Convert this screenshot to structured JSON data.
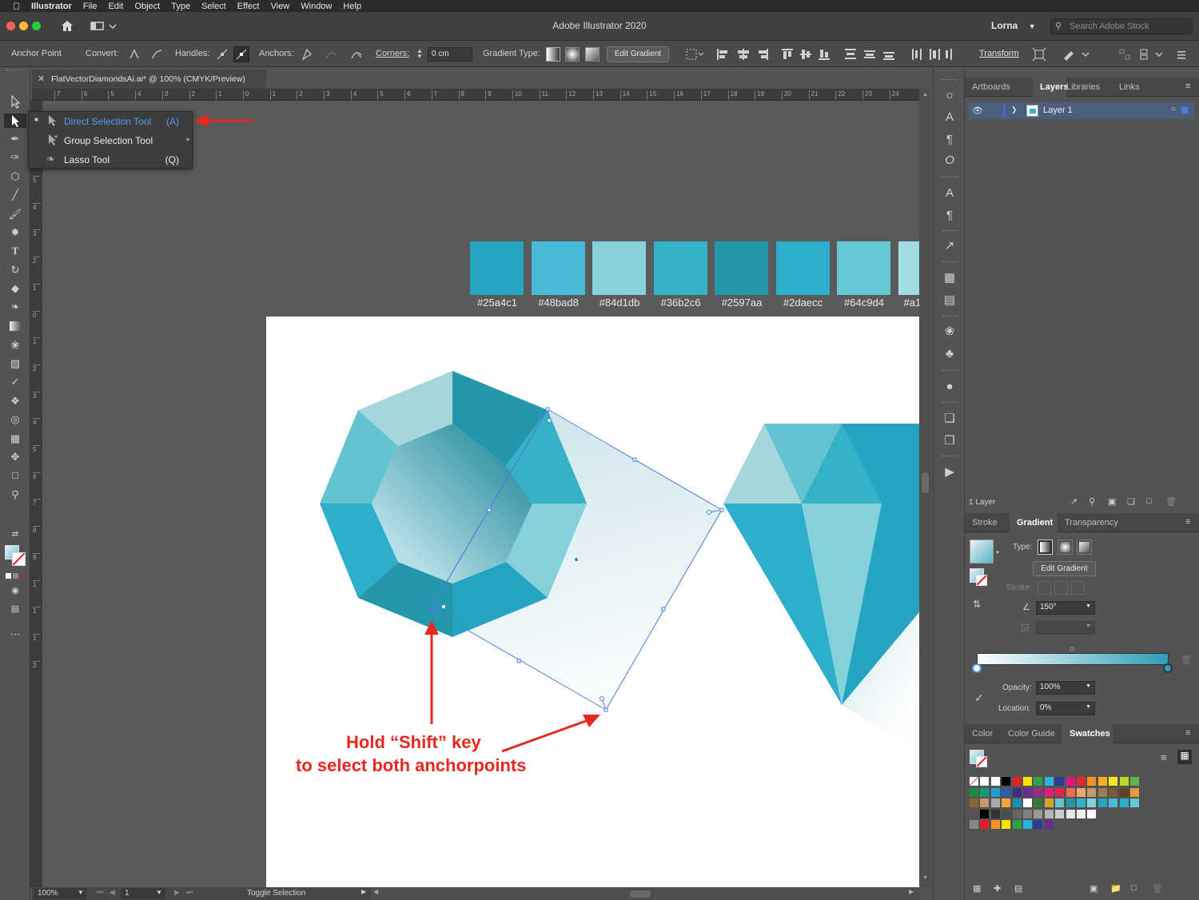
{
  "menubar": {
    "apple": "",
    "app": "Illustrator",
    "items": [
      "File",
      "Edit",
      "Object",
      "Type",
      "Select",
      "Effect",
      "View",
      "Window",
      "Help"
    ]
  },
  "titlebar": {
    "title": "Adobe Illustrator 2020",
    "user": "Lorna",
    "search_placeholder": "Search Adobe Stock"
  },
  "controlbar": {
    "context": "Anchor Point",
    "convert": "Convert:",
    "handles": "Handles:",
    "anchors": "Anchors:",
    "corners": "Corners:",
    "corners_value": "0 cm",
    "gradient_type": "Gradient Type:",
    "edit_gradient": "Edit Gradient",
    "transform": "Transform"
  },
  "document": {
    "tab_title": "FlatVectorDiamondsAi.ai* @ 100% (CMYK/Preview)"
  },
  "ruler_top": [
    "7",
    "6",
    "5",
    "4",
    "3",
    "2",
    "1",
    "0",
    "1",
    "2",
    "3",
    "4",
    "5",
    "6",
    "7",
    "8",
    "9",
    "10",
    "11",
    "12",
    "13",
    "14",
    "15",
    "16",
    "17",
    "18",
    "19",
    "20",
    "21",
    "22",
    "23",
    "24"
  ],
  "ruler_left": [
    "5",
    "4",
    "3",
    "2",
    "1",
    "0",
    "1",
    "2",
    "3",
    "4",
    "5",
    "6",
    "7",
    "8",
    "9",
    "1",
    "1",
    "1",
    "2"
  ],
  "flyout": {
    "items": [
      {
        "name": "Direct Selection Tool",
        "key": "(A)",
        "selected": true
      },
      {
        "name": "Group Selection Tool",
        "key": ""
      },
      {
        "name": "Lasso Tool",
        "key": "(Q)"
      }
    ]
  },
  "swatches": [
    {
      "label": "#25a4c1",
      "color": "#25a4c1"
    },
    {
      "label": "#48bad8",
      "color": "#48bad8"
    },
    {
      "label": "#84d1db",
      "color": "#84d1db"
    },
    {
      "label": "#36b2c6",
      "color": "#36b2c6"
    },
    {
      "label": "#2597aa",
      "color": "#2597aa"
    },
    {
      "label": "#2daecc",
      "color": "#2daecc"
    },
    {
      "label": "#64c9d4",
      "color": "#64c9d4"
    },
    {
      "label": "#a1",
      "color": "#a1dde3"
    }
  ],
  "annotation": {
    "line1": "Hold “Shift” key",
    "line2": "to select both anchorpoints",
    "color": "#e8281e"
  },
  "statusbar": {
    "zoom": "100%",
    "artboard": "1",
    "status": "Toggle Selection"
  },
  "layers_panel": {
    "tabs": [
      "Artboards",
      "Layers",
      "Libraries",
      "Links"
    ],
    "active_tab": "Layers",
    "layer_name": "Layer 1",
    "footer": "1 Layer"
  },
  "gradient_panel": {
    "tabs": [
      "Stroke",
      "Gradient",
      "Transparency"
    ],
    "active_tab": "Gradient",
    "type_label": "Type:",
    "edit_gradient": "Edit Gradient",
    "stroke_label": "Stroke:",
    "angle": "150°",
    "opacity_label": "Opacity:",
    "opacity": "100%",
    "location_label": "Location:",
    "location": "0%"
  },
  "swatches_panel": {
    "tabs": [
      "Color",
      "Color Guide",
      "Swatches"
    ],
    "active_tab": "Swatches"
  },
  "colors": {
    "accent": "#3d8be0",
    "selection": "#4a7de0",
    "annotation": "#e8281e"
  }
}
